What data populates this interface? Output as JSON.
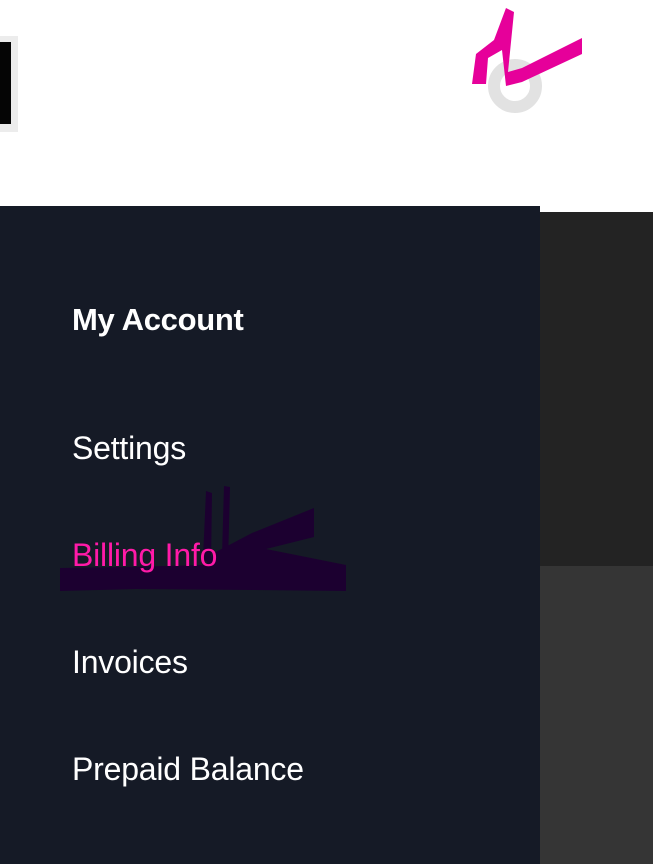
{
  "colors": {
    "drawer_background": "#151a26",
    "accent": "#ff1aa8",
    "menu_text": "#ffffff",
    "active_indicator": "#1c0030"
  },
  "header": {
    "logo_icon": "brand-logo-icon",
    "menu_toggle_icon": "menu-toggle-icon"
  },
  "drawer": {
    "heading": "My Account",
    "items": [
      {
        "label": "Settings",
        "active": false
      },
      {
        "label": "Billing Info",
        "active": true
      },
      {
        "label": "Invoices",
        "active": false
      },
      {
        "label": "Prepaid Balance",
        "active": false
      }
    ]
  }
}
